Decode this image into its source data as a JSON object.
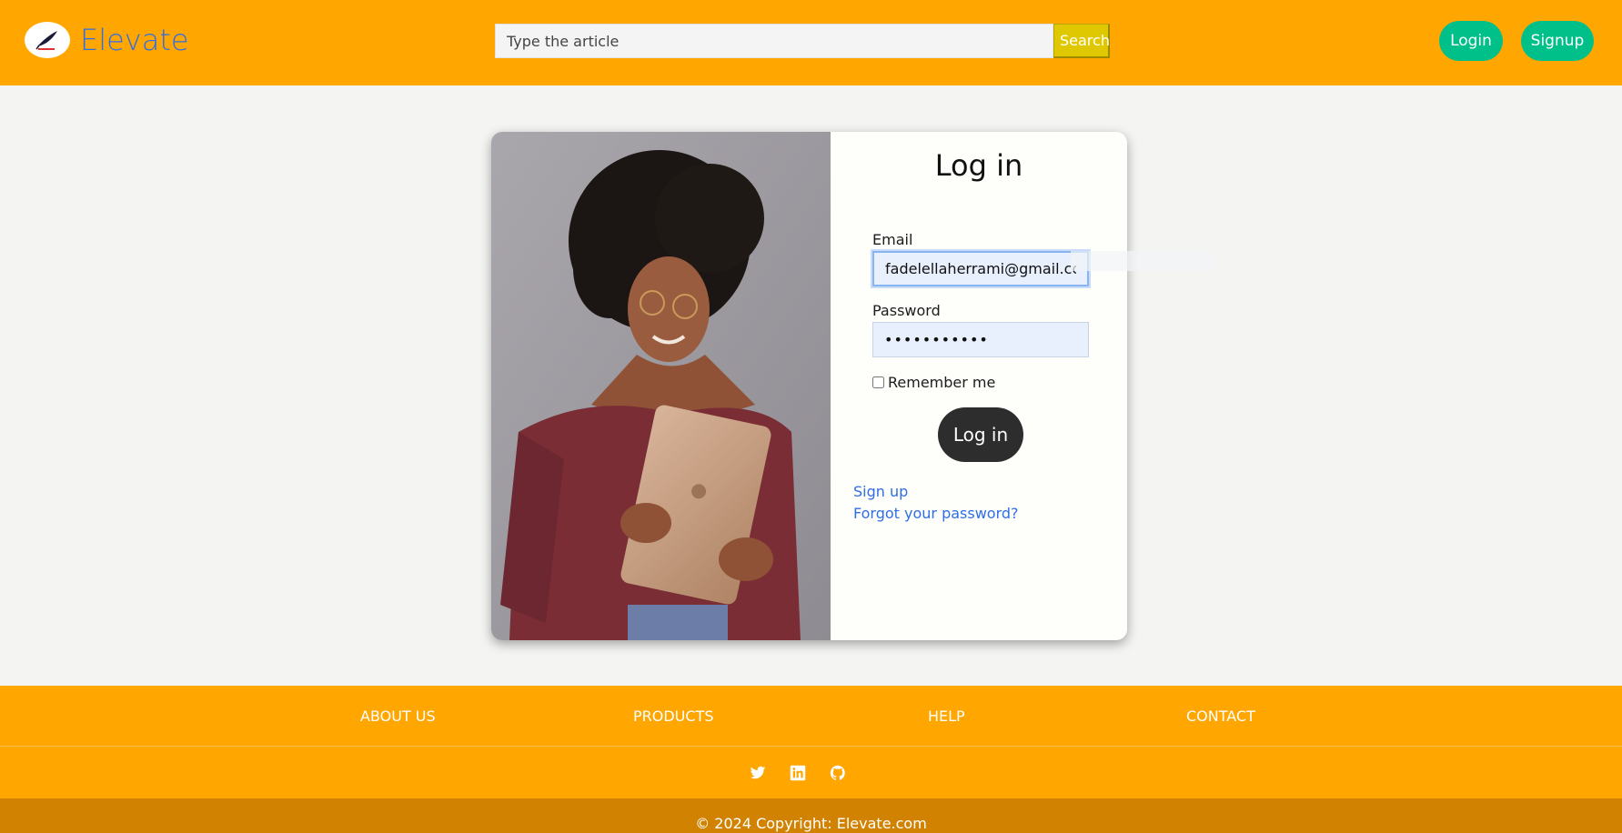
{
  "header": {
    "brand_name": "Elevate",
    "logo_icon": "feather-quill-logo",
    "search_placeholder": "Type the article",
    "search_button": "Search",
    "login_button": "Login",
    "signup_button": "Signup"
  },
  "login_form": {
    "title": "Log in",
    "email_label": "Email",
    "email_value": "fadelellaherrami@gmail.com",
    "password_label": "Password",
    "password_value": "•••••••••••",
    "remember_label": "Remember me",
    "submit_button": "Log in",
    "signup_link": "Sign up",
    "forgot_link": "Forgot your password?"
  },
  "footer": {
    "nav": [
      "ABOUT US",
      "PRODUCTS",
      "HELP",
      "CONTACT"
    ],
    "social_icons": [
      "twitter-icon",
      "linkedin-icon",
      "github-icon"
    ],
    "copyright": "© 2024 Copyright: Elevate.com"
  },
  "colors": {
    "header_bg": "#ffa600",
    "brand_blue": "#2f6ee5",
    "accent_green": "#00c08a",
    "search_yellow": "#e0c800",
    "copyright_bg": "#d18200",
    "dark_button": "#2d2d2d"
  }
}
